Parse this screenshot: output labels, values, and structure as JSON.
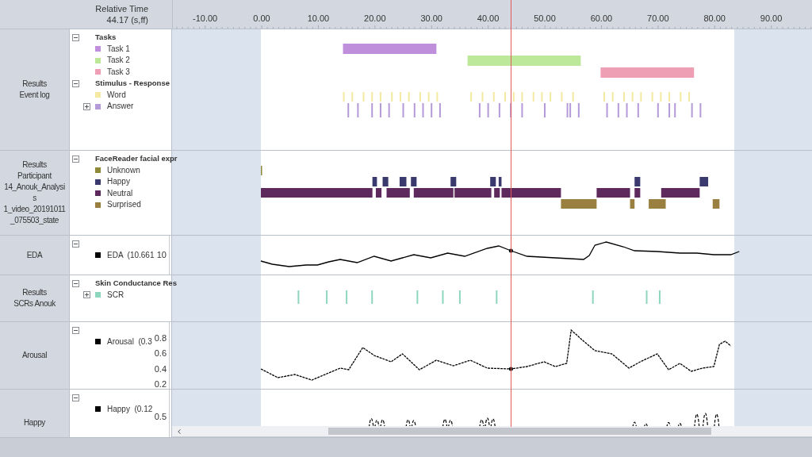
{
  "header": {
    "title": "Relative Time",
    "cursor_time": "44.17 (s,ff)"
  },
  "ruler": {
    "ticks": [
      "-10.00",
      "0.00",
      "10.00",
      "20.00",
      "30.00",
      "40.00",
      "50.00",
      "60.00",
      "70.00",
      "80.00",
      "90.00"
    ]
  },
  "tracks": [
    {
      "kind": "events",
      "label_lines": [
        "Results",
        "Event log"
      ],
      "groups": [
        {
          "title": "Tasks",
          "expanded": true,
          "items": [
            {
              "name": "Task 1",
              "color": "#c08fdc"
            },
            {
              "name": "Task 2",
              "color": "#bde89a"
            },
            {
              "name": "Task 3",
              "color": "#ee9fb3"
            }
          ]
        },
        {
          "title": "Stimulus - Response",
          "expanded": true,
          "items": [
            {
              "name": "Word",
              "color": "#f3e9a0"
            },
            {
              "name": "Answer",
              "color": "#b49ad8",
              "expanded": false
            }
          ]
        }
      ]
    },
    {
      "kind": "states",
      "label_lines": [
        "Results",
        "Participant",
        "14_Anouk_Analysi",
        "s",
        "1_video_20191011",
        "_075503_state"
      ],
      "groups": [
        {
          "title": "FaceReader facial expr",
          "expanded": true,
          "items": [
            {
              "name": "Unknown",
              "color": "#8f8a3a"
            },
            {
              "name": "Happy",
              "color": "#3b3a6e"
            },
            {
              "name": "Neutral",
              "color": "#5e2a5e"
            },
            {
              "name": "Surprised",
              "color": "#9a8040"
            }
          ]
        }
      ]
    },
    {
      "kind": "signal",
      "label_lines": [
        "EDA"
      ],
      "groups": [
        {
          "expanded": true,
          "items": [
            {
              "name": "EDA  (10.661",
              "color": "#000000"
            }
          ]
        }
      ],
      "y_ticks": [
        "10"
      ]
    },
    {
      "kind": "markers",
      "label_lines": [
        "Results",
        "SCRs Anouk"
      ],
      "groups": [
        {
          "title": "Skin Conductance Res",
          "expanded": true,
          "items": [
            {
              "name": "SCR",
              "color": "#8fd6be",
              "expanded": false
            }
          ]
        }
      ]
    },
    {
      "kind": "signal",
      "label_lines": [
        "Arousal"
      ],
      "groups": [
        {
          "expanded": true,
          "items": [
            {
              "name": "Arousal  (0.3",
              "color": "#000000"
            }
          ]
        }
      ],
      "y_ticks": [
        "0.8",
        "0.6",
        "0.4",
        "0.2"
      ]
    },
    {
      "kind": "signal",
      "label_lines": [
        "Happy"
      ],
      "groups": [
        {
          "expanded": true,
          "items": [
            {
              "name": "Happy  (0.12",
              "color": "#000000"
            }
          ]
        }
      ],
      "y_ticks": [
        "0.5"
      ]
    }
  ]
}
